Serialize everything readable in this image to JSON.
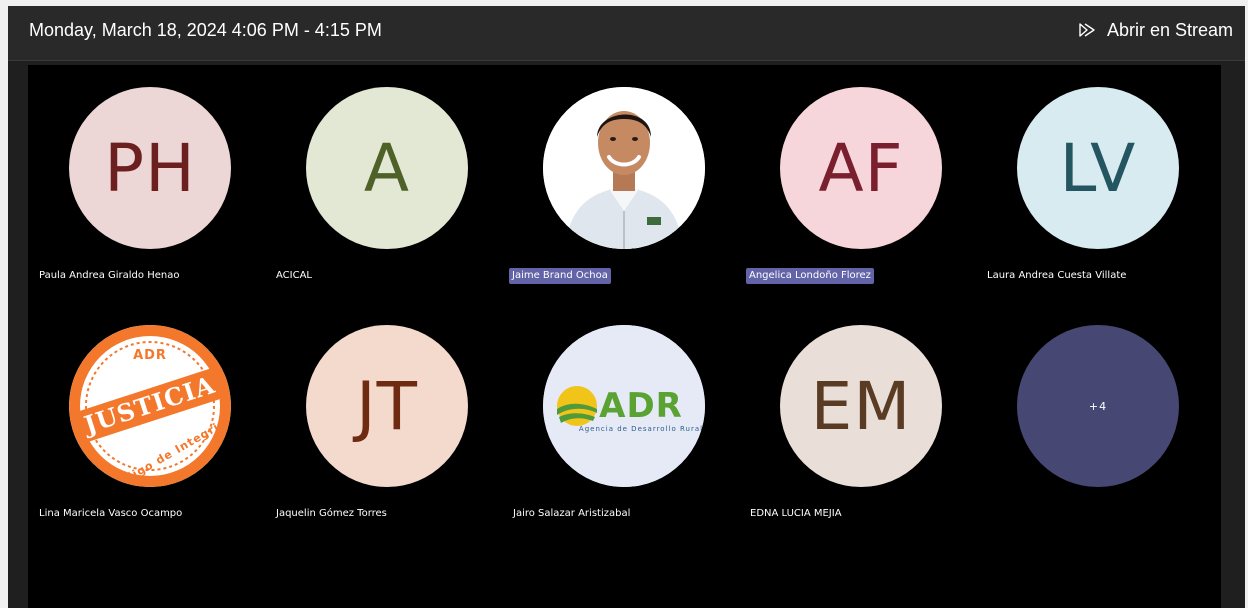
{
  "header": {
    "title": "Monday, March 18, 2024 4:06 PM - 4:15 PM",
    "stream_label": "Abrir en Stream"
  },
  "colors": {
    "speaking_badge": "#6264a7",
    "stage_bg": "#000000",
    "header_bg": "#292929"
  },
  "participants": [
    {
      "name": "Paula Andrea Giraldo Henao",
      "initials": "PH",
      "avatar_bg": "#ecd6d6",
      "avatar_fg": "#6b1f1f",
      "highlight": false
    },
    {
      "name": "ACICAL",
      "initials": "A",
      "avatar_bg": "#e3e8d5",
      "avatar_fg": "#4e6128",
      "highlight": false
    },
    {
      "name": "Jaime Brand Ochoa",
      "initials": "",
      "avatar_type": "photo",
      "highlight": true
    },
    {
      "name": "Angelica Londoño Florez",
      "initials": "AF",
      "avatar_bg": "#f6d6db",
      "avatar_fg": "#7a1f2e",
      "highlight": true
    },
    {
      "name": "Laura Andrea Cuesta Villate",
      "initials": "LV",
      "avatar_bg": "#d7ebf0",
      "avatar_fg": "#245661",
      "highlight": false
    },
    {
      "name": "Lina Maricela Vasco Ocampo",
      "initials": "",
      "avatar_type": "logo",
      "logo_text": {
        "top": "ADR",
        "main": "JUSTICIA",
        "bottom": "Código de Integridad"
      },
      "highlight": false
    },
    {
      "name": "Jaquelin Gómez Torres",
      "initials": "JT",
      "avatar_bg": "#f4d9cd",
      "avatar_fg": "#6e2b12",
      "highlight": false
    },
    {
      "name": "Jairo Salazar Aristizabal",
      "initials": "",
      "avatar_type": "logo",
      "logo_text": {
        "main": "ADR",
        "sub": "Agencia de Desarrollo Rural"
      },
      "highlight": false
    },
    {
      "name": "EDNA LUCIA MEJIA",
      "initials": "EM",
      "avatar_bg": "#eadfd8",
      "avatar_fg": "#5a3b24",
      "highlight": false
    }
  ],
  "overflow": {
    "label": "+4",
    "bg": "#474774"
  }
}
